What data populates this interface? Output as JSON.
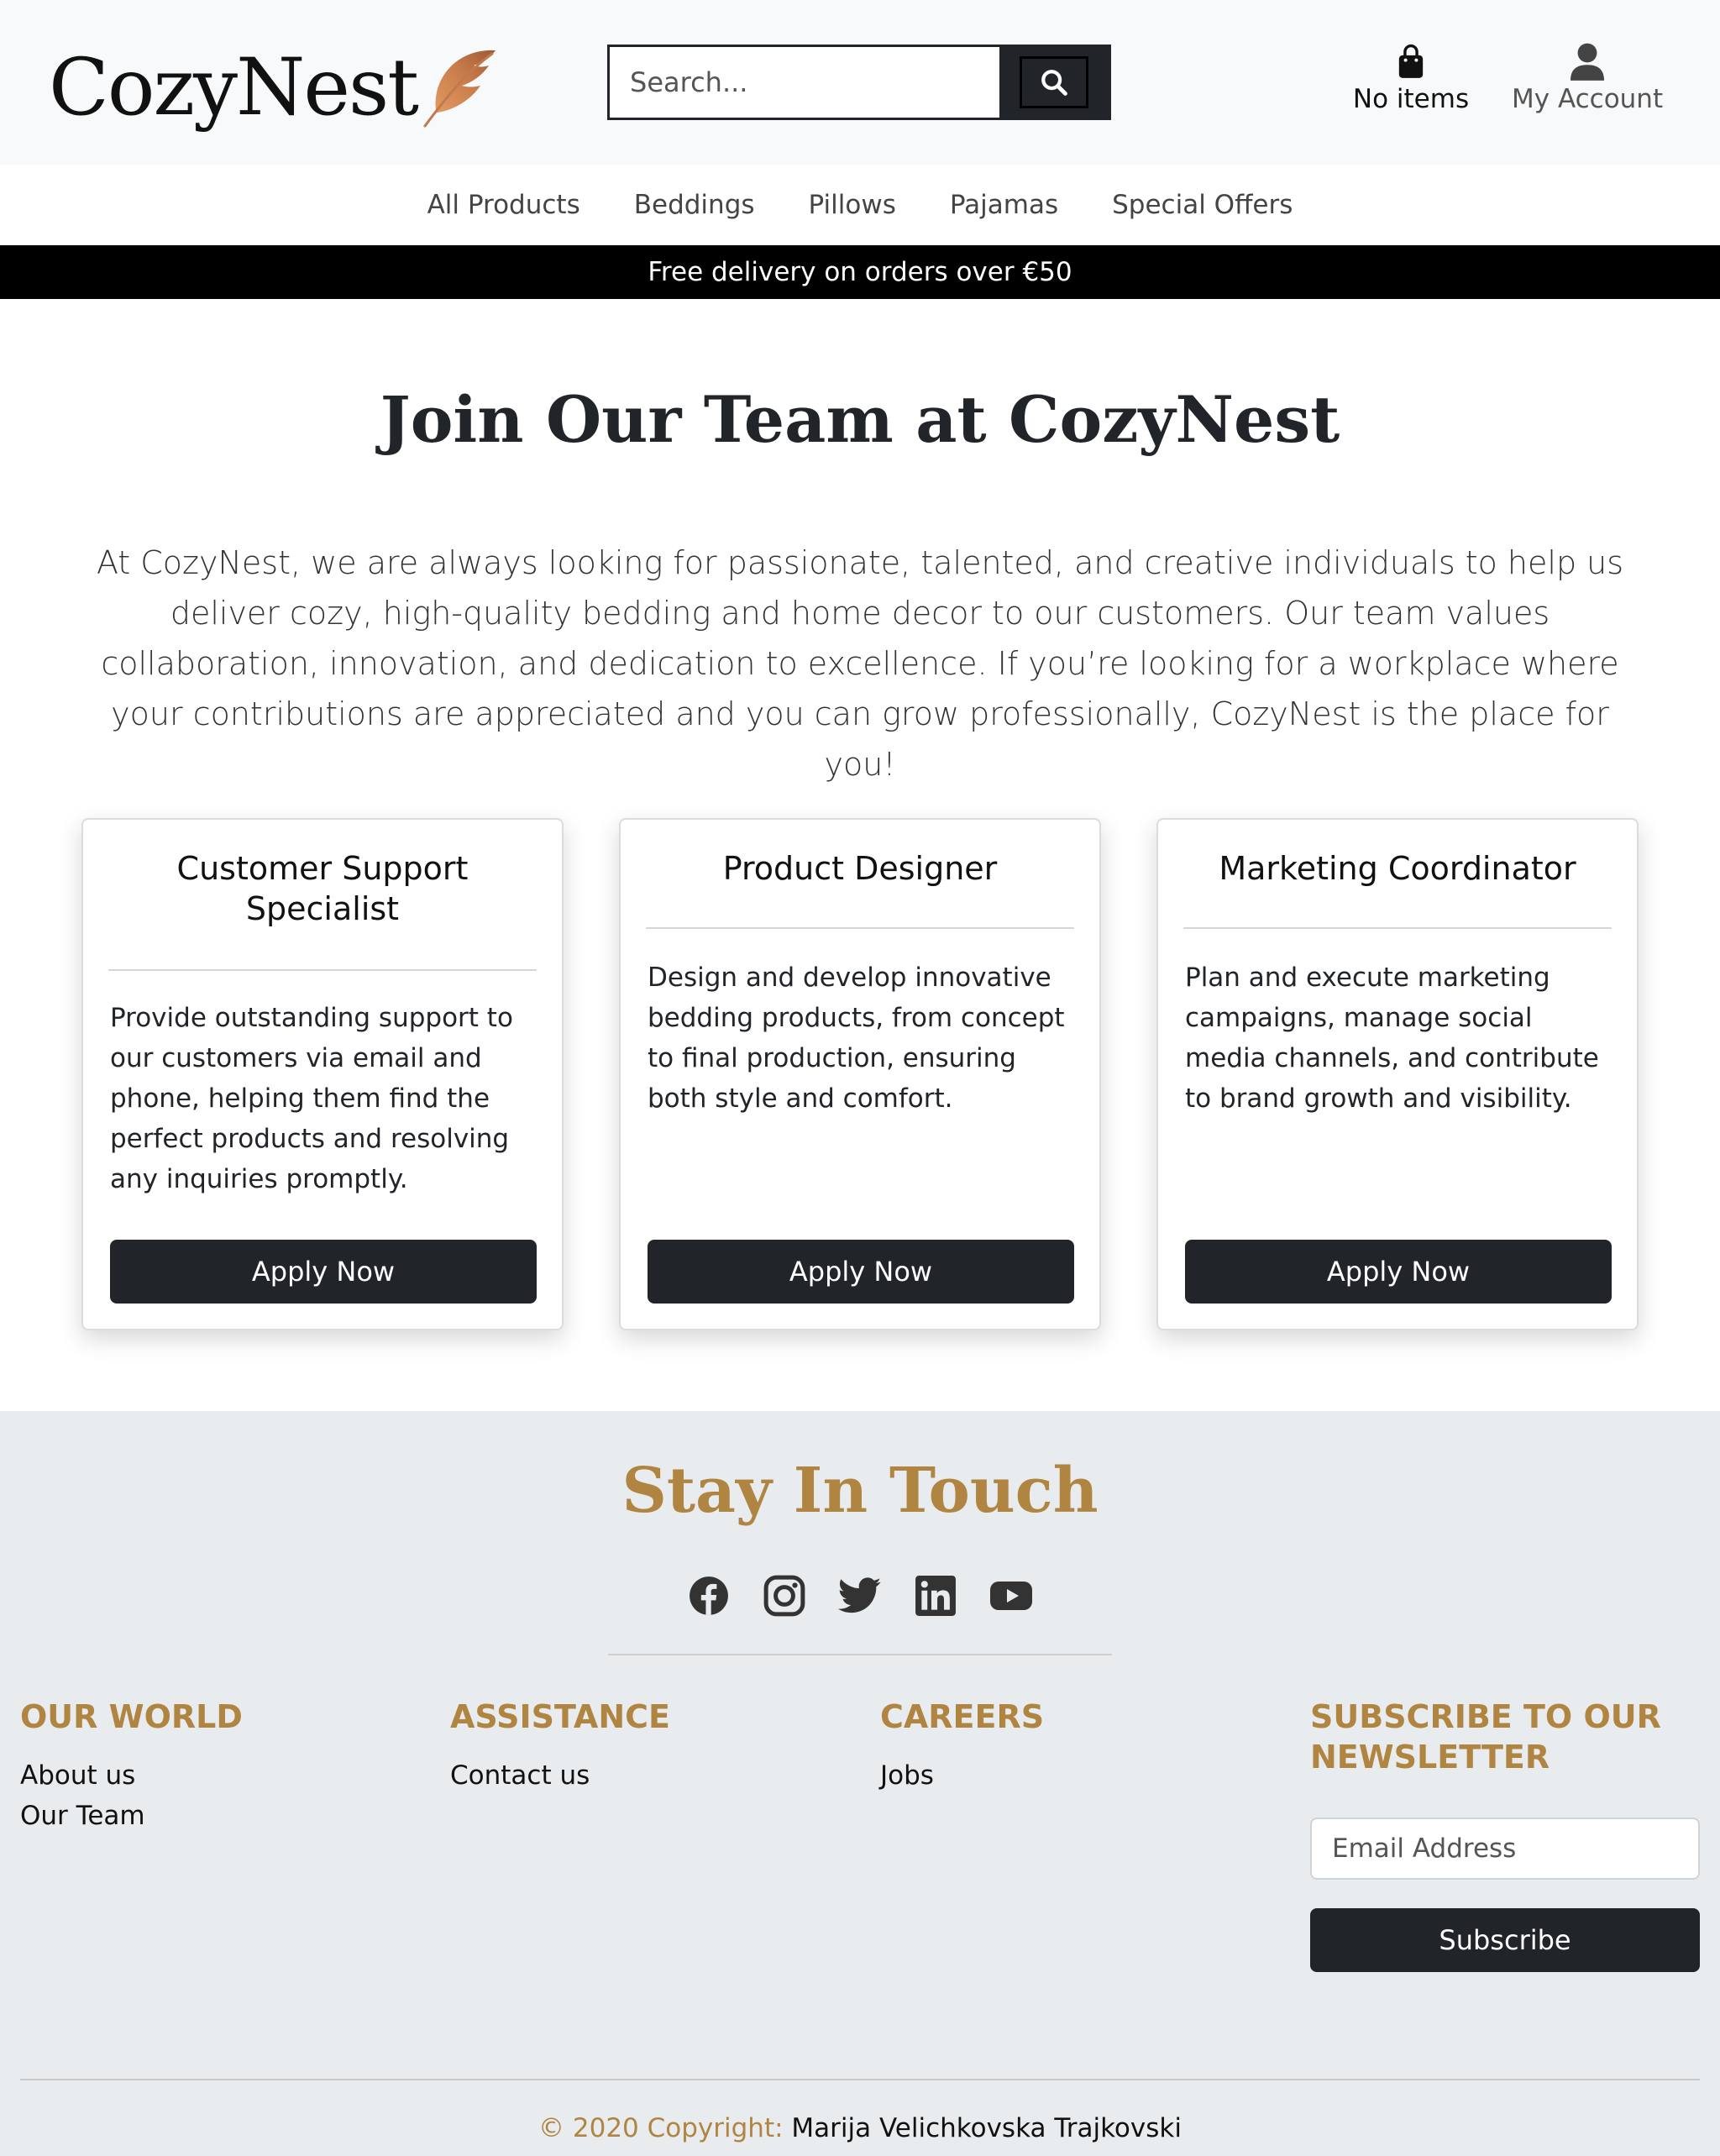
{
  "header": {
    "brand": "CozyNest",
    "search": {
      "placeholder": "Search...",
      "value": ""
    },
    "cart_label": "No items",
    "account_label": "My Account"
  },
  "nav": {
    "items": [
      "All Products",
      "Beddings",
      "Pillows",
      "Pajamas",
      "Special Offers"
    ]
  },
  "banner": {
    "text": "Free delivery on orders over €50"
  },
  "main": {
    "title": "Join Our Team at CozyNest",
    "intro": "At CozyNest, we are always looking for passionate, talented, and creative individuals to help us deliver cozy, high-quality bedding and home decor to our customers. Our team values collaboration, innovation, and dedication to excellence. If you’re looking for a workplace where your contributions are appreciated and you can grow professionally, CozyNest is the place for you!",
    "jobs": [
      {
        "title": "Customer Support Specialist",
        "description": "Provide outstanding support to our customers via email and phone, helping them find the perfect products and resolving any inquiries promptly.",
        "button": "Apply Now"
      },
      {
        "title": "Product Designer",
        "description": "Design and develop innovative bedding products, from concept to final production, ensuring both style and comfort.",
        "button": "Apply Now"
      },
      {
        "title": "Marketing Coordinator",
        "description": "Plan and execute marketing campaigns, manage social media channels, and contribute to brand growth and visibility.",
        "button": "Apply Now"
      }
    ]
  },
  "footer": {
    "heading": "Stay In Touch",
    "social_icons": [
      "facebook-icon",
      "instagram-icon",
      "twitter-icon",
      "linkedin-icon",
      "youtube-icon"
    ],
    "columns": [
      {
        "title": "OUR WORLD",
        "links": [
          "About us",
          "Our Team"
        ]
      },
      {
        "title": "ASSISTANCE",
        "links": [
          "Contact us"
        ]
      },
      {
        "title": "CAREERS",
        "links": [
          "Jobs"
        ]
      }
    ],
    "newsletter": {
      "title": "SUBSCRIBE TO OUR NEWSLETTER",
      "email_placeholder": "Email Address",
      "button": "Subscribe"
    },
    "copyright_prefix": "© 2020 Copyright:",
    "copyright_author": "Marija Velichkovska Trajkovski"
  },
  "colors": {
    "accent_gold": "#b08542",
    "dark": "#212529",
    "banner": "#000000",
    "footer_bg": "#e9ecef",
    "header_bg": "#f8f9fa"
  }
}
